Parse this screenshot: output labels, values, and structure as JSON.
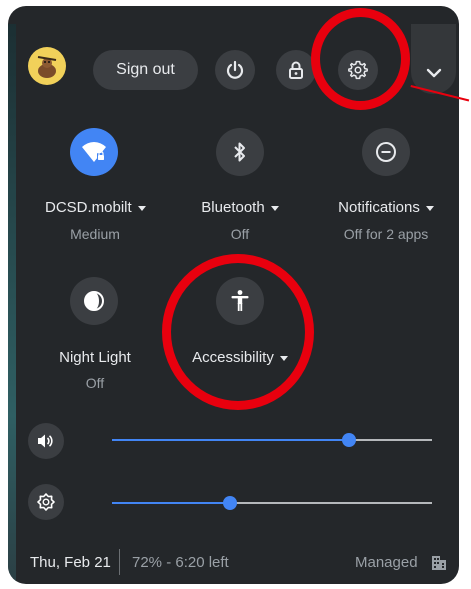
{
  "header": {
    "sign_out_label": "Sign out"
  },
  "tiles": [
    {
      "label": "DCSD.mobilt",
      "status": "Medium",
      "icon": "wifi-lock-icon",
      "active": true
    },
    {
      "label": "Bluetooth",
      "status": "Off",
      "icon": "bluetooth-icon",
      "active": false
    },
    {
      "label": "Notifications",
      "status": "Off for 2 apps",
      "icon": "notifications-icon",
      "active": false
    },
    {
      "label": "Night Light",
      "status": "Off",
      "icon": "night-light-icon",
      "active": false
    },
    {
      "label": "Accessibility",
      "status": "",
      "icon": "accessibility-icon",
      "active": false
    }
  ],
  "sliders": {
    "volume": {
      "icon": "volume-icon",
      "level": 0.74
    },
    "brightness": {
      "icon": "brightness-icon",
      "level": 0.37
    }
  },
  "footer": {
    "date": "Thu, Feb 21",
    "battery": "72% - 6:20 left",
    "managed": "Managed"
  },
  "colors": {
    "panel": "#24272a",
    "button": "#3b3e42",
    "accent": "#4285f4",
    "annotation": "#e8000e"
  }
}
